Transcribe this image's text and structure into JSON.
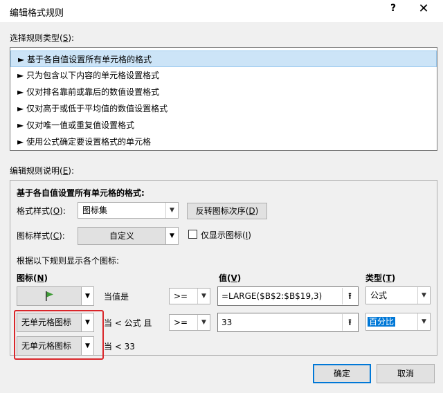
{
  "window": {
    "title": "编辑格式规则",
    "help": "?",
    "close": "✕"
  },
  "rule_type": {
    "label": "选择规则类型(",
    "label_key": "S",
    "label_end": "):",
    "arrow": "►",
    "items": [
      "基于各自值设置所有单元格的格式",
      "只为包含以下内容的单元格设置格式",
      "仅对排名靠前或靠后的数值设置格式",
      "仅对高于或低于平均值的数值设置格式",
      "仅对唯一值或重复值设置格式",
      "使用公式确定要设置格式的单元格"
    ]
  },
  "edit": {
    "label": "编辑规则说明(",
    "label_key": "E",
    "label_end": "):",
    "heading": "基于各自值设置所有单元格的格式:",
    "format_style": {
      "label": "格式样式(",
      "key": "O",
      "end": "):",
      "value": "图标集"
    },
    "reverse_button": {
      "label": "反转图标次序(",
      "key": "D",
      "end": ")"
    },
    "icon_style": {
      "label": "图标样式(",
      "key": "C",
      "end": "):",
      "value": "自定义"
    },
    "show_icon_only": {
      "label": "仅显示图标(",
      "key": "I",
      "end": ")"
    },
    "rules_caption": "根据以下规则显示各个图标:",
    "col_icon": {
      "label": "图标(",
      "key": "N",
      "end": ")"
    },
    "col_value": {
      "label": "值(",
      "key": "V",
      "end": ")"
    },
    "col_type": {
      "label": "类型(",
      "key": "T",
      "end": ")"
    },
    "rows": [
      {
        "icon": "flag",
        "condition": "当值是",
        "op": ">=",
        "value": "=LARGE($B$2:$B$19,3)",
        "type": "公式"
      },
      {
        "icon": "无单元格图标",
        "condition": "当 < 公式 且",
        "op": ">=",
        "value": "33",
        "type": "百分比"
      },
      {
        "icon": "无单元格图标",
        "condition": "当 < 33"
      }
    ]
  },
  "buttons": {
    "ok": "确定",
    "cancel": "取消"
  },
  "colors": {
    "accent": "#0078d7",
    "selection": "#cce4f7",
    "highlight_box": "#d9262a",
    "flag": "#3d9b35"
  }
}
